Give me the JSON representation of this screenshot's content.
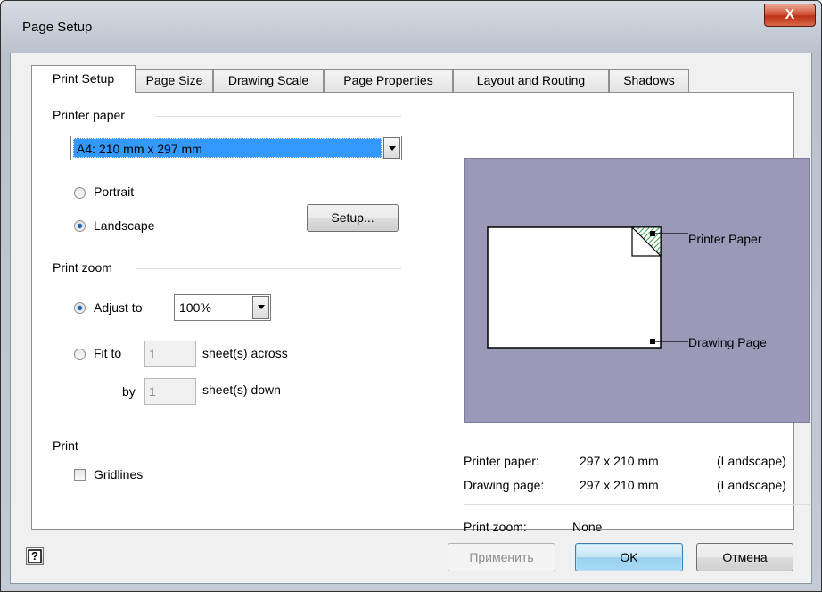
{
  "window": {
    "title": "Page Setup",
    "close_label": "X"
  },
  "tabs": [
    {
      "label": "Print Setup",
      "active": true
    },
    {
      "label": "Page Size"
    },
    {
      "label": "Drawing Scale"
    },
    {
      "label": "Page Properties"
    },
    {
      "label": "Layout and Routing"
    },
    {
      "label": "Shadows"
    }
  ],
  "printer_paper": {
    "group_label": "Printer paper",
    "selected": "A4:  210 mm x 297 mm",
    "portrait_label": "Portrait",
    "landscape_label": "Landscape",
    "orientation": "Landscape",
    "setup_label": "Setup..."
  },
  "print_zoom": {
    "group_label": "Print zoom",
    "adjust_label": "Adjust to",
    "adjust_value": "100%",
    "fit_label": "Fit to",
    "across_value": "1",
    "across_label": "sheet(s) across",
    "by_label": "by",
    "down_value": "1",
    "down_label": "sheet(s) down"
  },
  "print": {
    "group_label": "Print",
    "gridlines_label": "Gridlines",
    "gridlines_checked": false
  },
  "preview": {
    "printer_paper_label": "Printer Paper",
    "drawing_page_label": "Drawing Page"
  },
  "info": {
    "printer_paper_label": "Printer paper:",
    "printer_paper_value": "297 x 210 mm",
    "printer_paper_orientation": "(Landscape)",
    "drawing_page_label": "Drawing page:",
    "drawing_page_value": "297 x 210 mm",
    "drawing_page_orientation": "(Landscape)",
    "print_zoom_label": "Print zoom:",
    "print_zoom_value": "None"
  },
  "buttons": {
    "apply": "Применить",
    "ok": "OK",
    "cancel": "Отмена",
    "help_icon": "?"
  },
  "colors": {
    "preview_bg": "#9a9ab8",
    "selection": "#3399ff",
    "hatch": "#3aa34a"
  }
}
